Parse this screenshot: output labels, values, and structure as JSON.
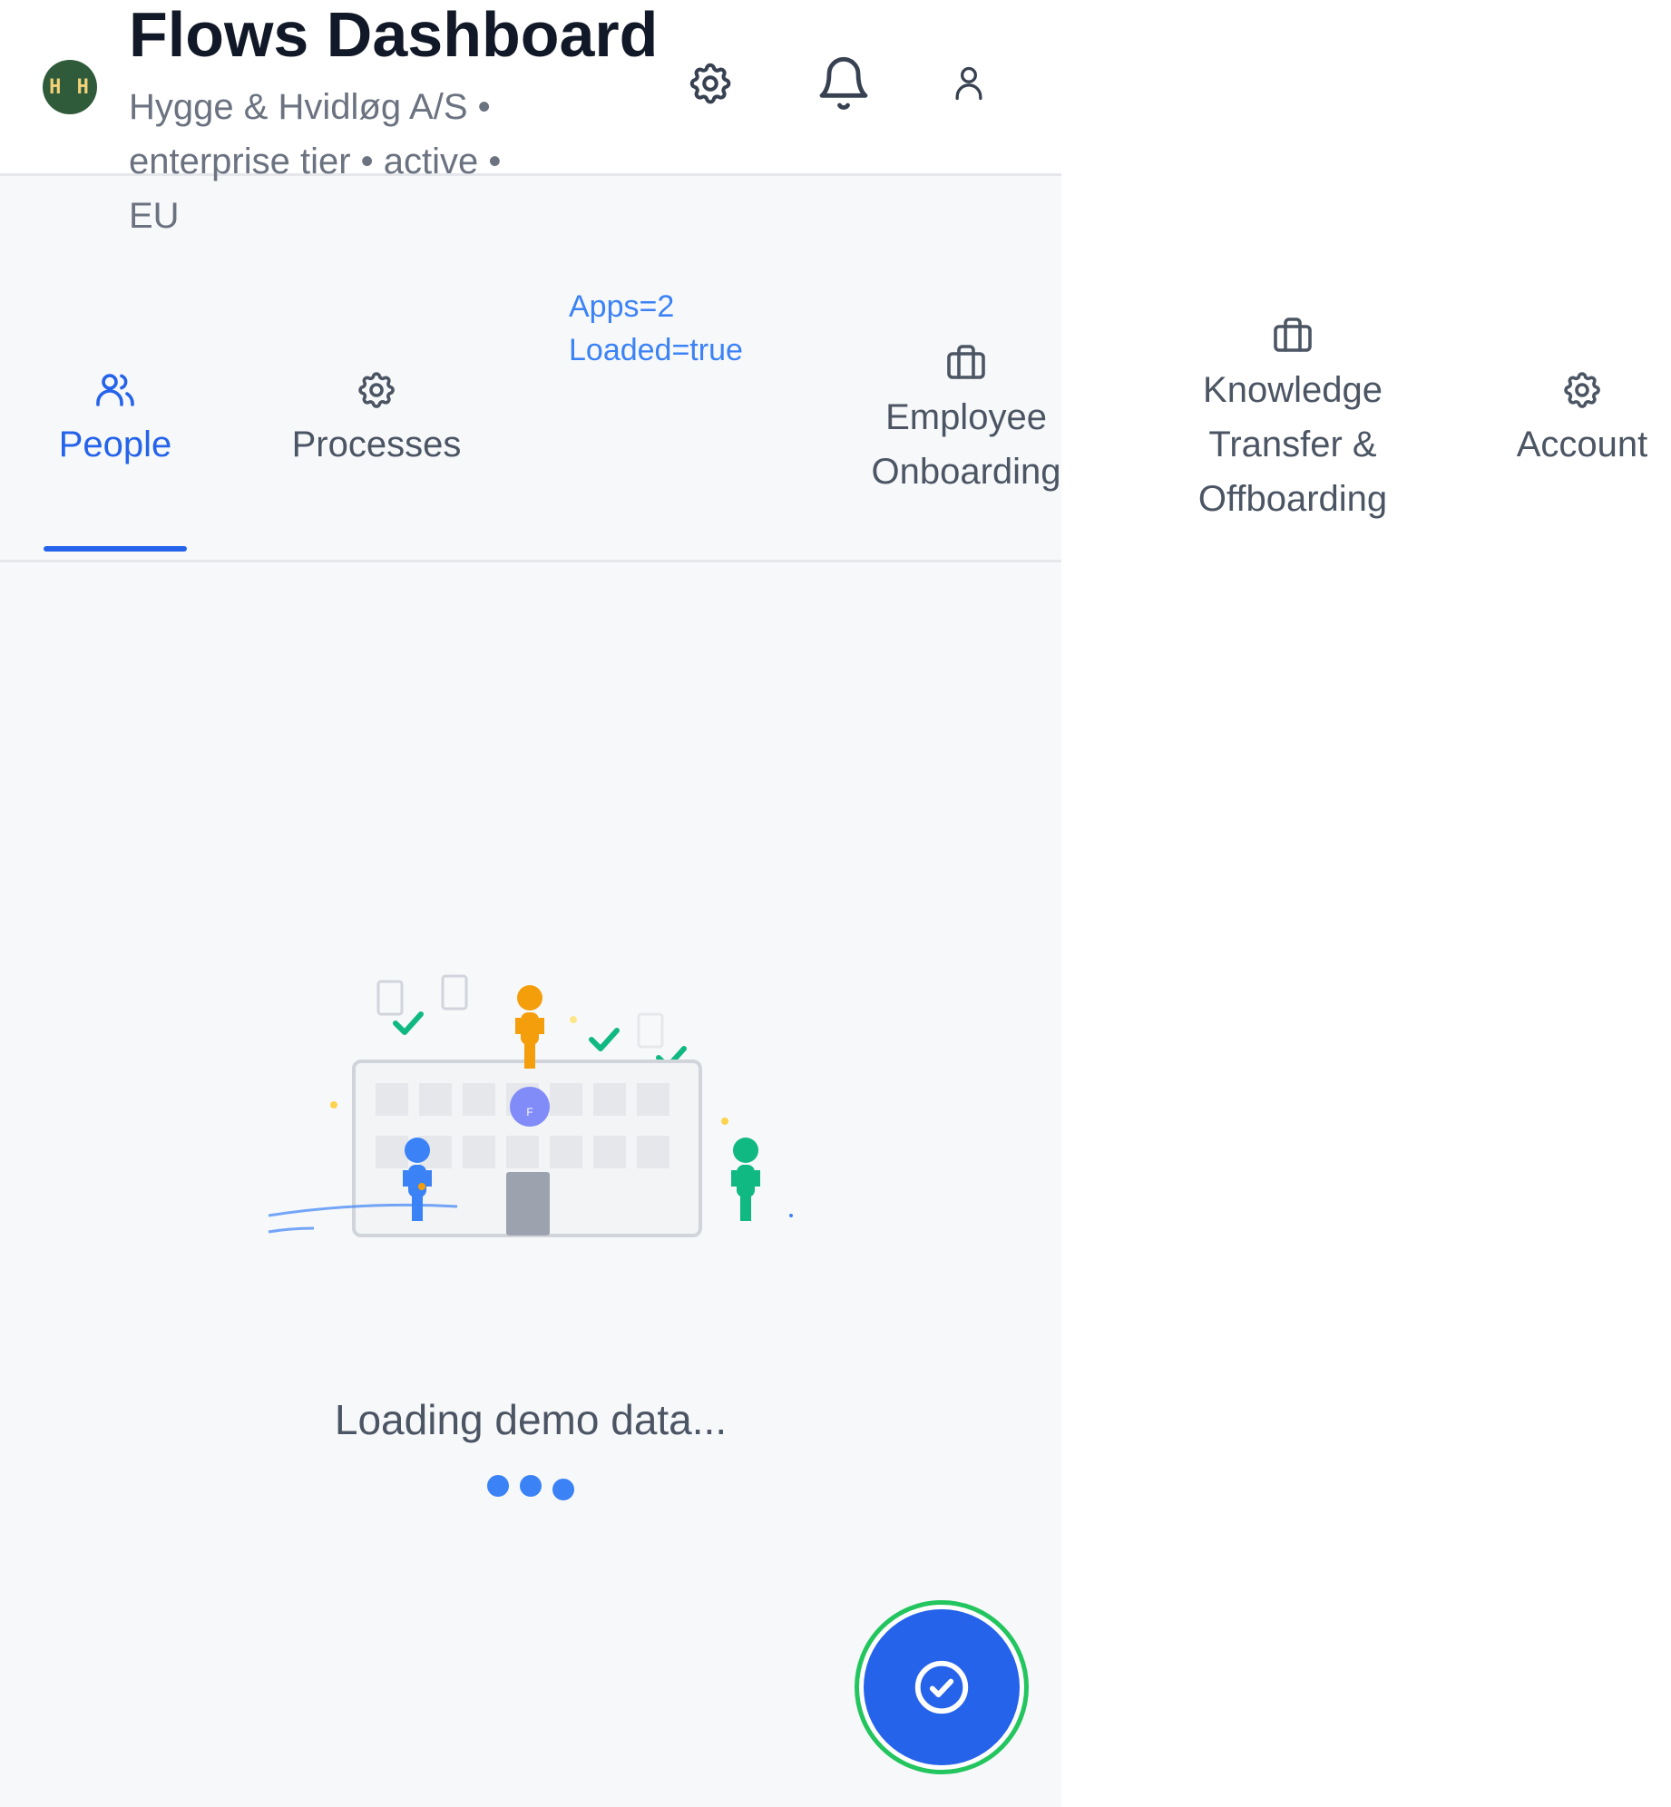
{
  "header": {
    "logo_text": "H H",
    "title": "Flows Dashboard",
    "subtitle": "Hygge & Hvidløg A/S • enterprise tier • active • EU",
    "icons": [
      "gear-icon",
      "bell-icon",
      "user-icon"
    ]
  },
  "debug": {
    "line1": "Apps=2",
    "line2": "Loaded=true"
  },
  "tabs": [
    {
      "label": "People",
      "icon": "people-icon",
      "active": true
    },
    {
      "label": "Processes",
      "icon": "gear-icon",
      "active": false
    },
    {
      "label": "Employee Onboarding",
      "icon": "briefcase-icon",
      "active": false
    },
    {
      "label": "Knowledge Transfer & Offboarding",
      "icon": "briefcase-icon",
      "active": false
    },
    {
      "label": "Account",
      "icon": "gear-icon",
      "active": false
    }
  ],
  "illustration": {
    "avatar_letter": "F"
  },
  "loading": {
    "text": "Loading demo data..."
  },
  "fab": {
    "icon": "check-circle-icon"
  },
  "colors": {
    "accent": "#2563eb",
    "muted_text": "#6b7280",
    "fab_ring": "#22c55e",
    "logo_bg": "#2f5b3a"
  }
}
